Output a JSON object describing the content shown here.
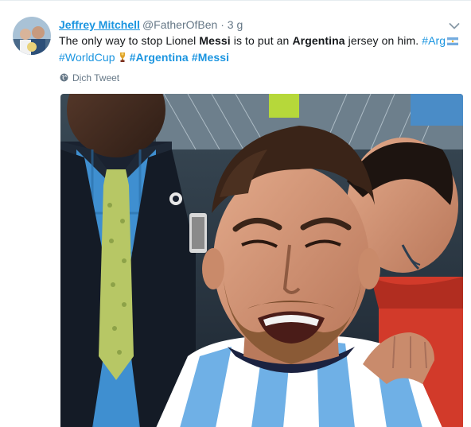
{
  "tweet": {
    "display_name": "Jeffrey Mitchell",
    "handle": "@FatherOfBen",
    "separator": "·",
    "time": "3 g",
    "text": {
      "p1": "The only way to stop Lionel ",
      "k1": "Messi",
      "p2": " is to put an ",
      "k2": "Argentina",
      "p3": " jersey on him. ",
      "tag_arg": "#Arg",
      "tag_worldcup": "#WorldCup",
      "tag_argentina": "#Argentina",
      "tag_messi": "#Messi"
    },
    "translate_label": "Dịch Tweet"
  },
  "colors": {
    "link": "#1b95e0",
    "text": "#14171a",
    "muted": "#657786"
  },
  "icons": {
    "caret": "chevron-down-icon",
    "translate": "globe-icon",
    "flag": "argentina-flag-icon",
    "trophy": "world-cup-trophy-icon"
  }
}
